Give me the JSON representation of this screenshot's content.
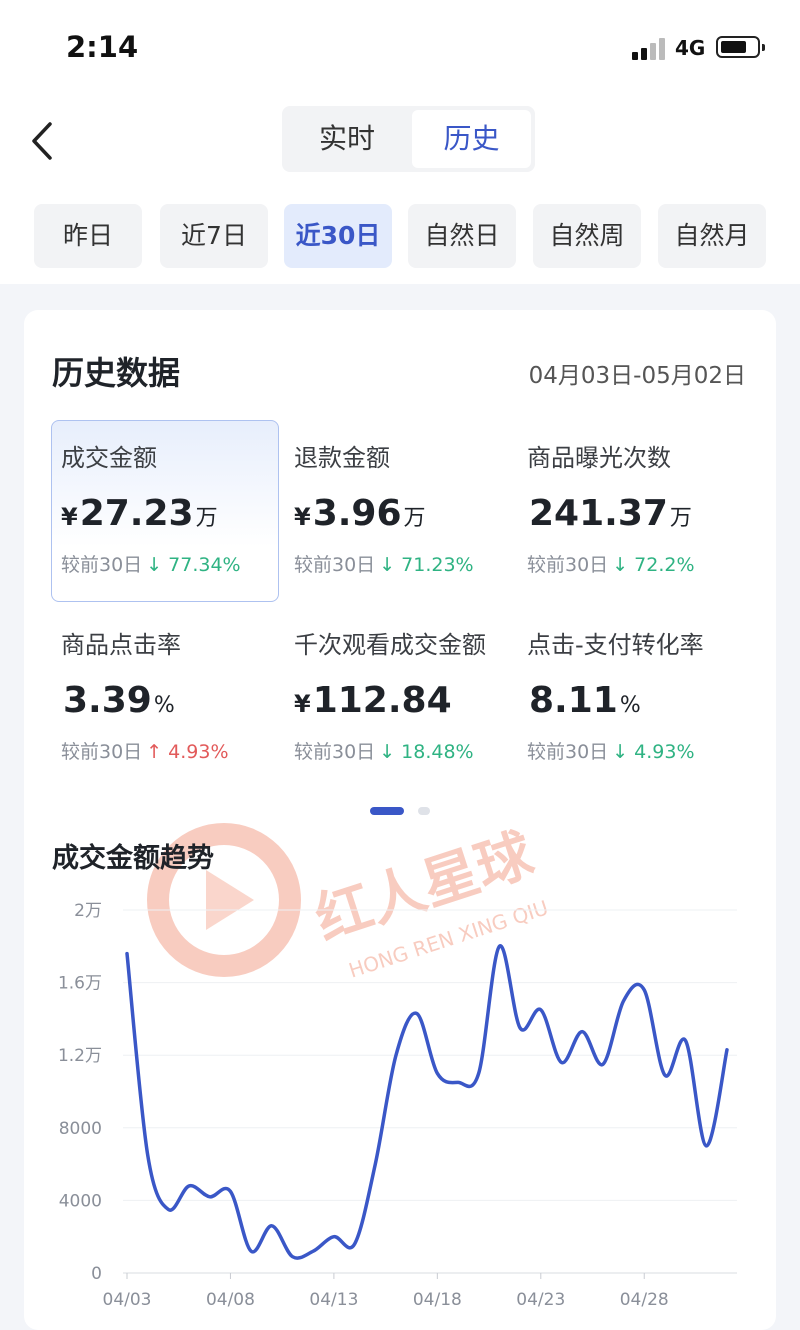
{
  "status_bar": {
    "time": "2:14",
    "network": "4G"
  },
  "tabs": [
    {
      "label": "实时"
    },
    {
      "label": "历史"
    }
  ],
  "ranges": [
    {
      "label": "昨日"
    },
    {
      "label": "近7日"
    },
    {
      "label": "近30日"
    },
    {
      "label": "自然日"
    },
    {
      "label": "自然周"
    },
    {
      "label": "自然月"
    }
  ],
  "active_range_index": 2,
  "card": {
    "title": "历史数据",
    "date_range": "04月03日-05月02日",
    "metrics": [
      {
        "label": "成交金额",
        "currency": "¥",
        "value": "27.23",
        "unit": "万",
        "compare_label": "较前30日",
        "direction": "down",
        "arrow": "↓",
        "change": "77.34%"
      },
      {
        "label": "退款金额",
        "currency": "¥",
        "value": "3.96",
        "unit": "万",
        "compare_label": "较前30日",
        "direction": "down",
        "arrow": "↓",
        "change": "71.23%"
      },
      {
        "label": "商品曝光次数",
        "currency": "",
        "value": "241.37",
        "unit": "万",
        "compare_label": "较前30日",
        "direction": "down",
        "arrow": "↓",
        "change": "72.2%"
      },
      {
        "label": "商品点击率",
        "currency": "",
        "value": "3.39",
        "unit": "%",
        "compare_label": "较前30日",
        "direction": "up",
        "arrow": "↑",
        "change": "4.93%"
      },
      {
        "label": "千次观看成交金额",
        "currency": "¥",
        "value": "112.84",
        "unit": "",
        "compare_label": "较前30日",
        "direction": "down",
        "arrow": "↓",
        "change": "18.48%"
      },
      {
        "label": "点击-支付转化率",
        "currency": "",
        "value": "8.11",
        "unit": "%",
        "compare_label": "较前30日",
        "direction": "down",
        "arrow": "↓",
        "change": "4.93%"
      }
    ],
    "trend_title": "成交金额趋势"
  },
  "colors": {
    "accent": "#3a57c7",
    "down": "#2fb383",
    "up": "#e25a5a"
  },
  "chart_data": {
    "type": "line",
    "title": "成交金额趋势",
    "y_tick_labels": [
      "0",
      "4000",
      "8000",
      "1.2万",
      "1.6万",
      "2万"
    ],
    "ylim": [
      0,
      20000
    ],
    "x_tick_labels": [
      "04/03",
      "04/08",
      "04/13",
      "04/18",
      "04/23",
      "04/28"
    ],
    "x": [
      "04/03",
      "04/04",
      "04/05",
      "04/06",
      "04/07",
      "04/08",
      "04/09",
      "04/10",
      "04/11",
      "04/12",
      "04/13",
      "04/14",
      "04/15",
      "04/16",
      "04/17",
      "04/18",
      "04/19",
      "04/20",
      "04/21",
      "04/22",
      "04/23",
      "04/24",
      "04/25",
      "04/26",
      "04/27",
      "04/28",
      "04/29",
      "04/30",
      "05/01",
      "05/02"
    ],
    "series": [
      {
        "values": [
          17600,
          6500,
          3500,
          4800,
          4200,
          4500,
          1200,
          2600,
          900,
          1200,
          2000,
          1600,
          6000,
          12000,
          14300,
          11000,
          10500,
          11000,
          18000,
          13500,
          14500,
          11600,
          13300,
          11500,
          15000,
          15600,
          10900,
          12800,
          7000,
          12300
        ]
      }
    ],
    "grid": true,
    "legend": "none"
  },
  "watermark": {
    "cn": "红人星球",
    "en": "HONG REN XING QIU"
  }
}
